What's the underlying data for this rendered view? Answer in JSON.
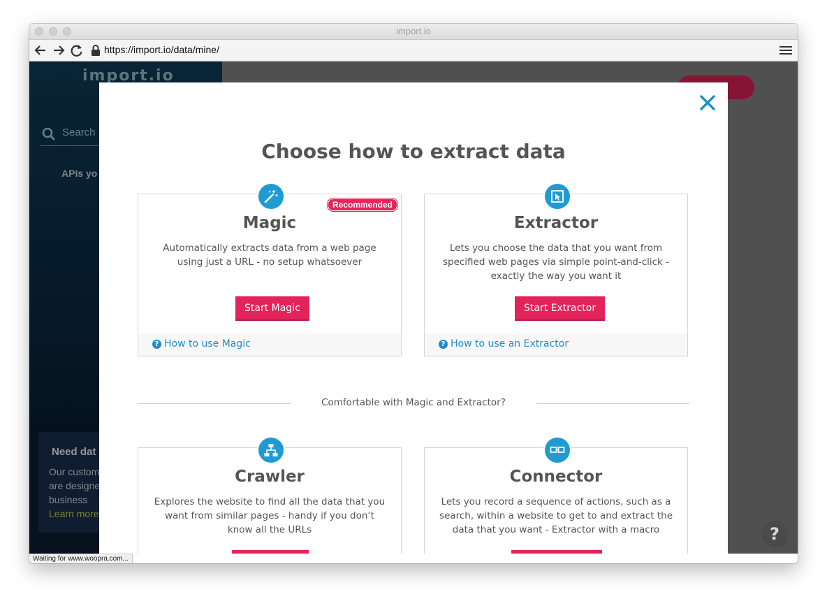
{
  "window": {
    "title": "import.io"
  },
  "browser": {
    "url": "https://import.io/data/mine/"
  },
  "sidebar": {
    "brand": "import.io",
    "search_label": "Search",
    "section_label": "APIs yo",
    "promo": {
      "title": "Need dat",
      "text_line1": "Our custom",
      "text_line2": "are designe",
      "text_line3": "business",
      "link": "Learn more"
    }
  },
  "modal": {
    "title": "Choose how to extract data",
    "divider_text": "Comfortable with Magic and Extractor?",
    "cards": [
      {
        "icon": "magic-wand-icon",
        "badge": "Recommended",
        "title": "Magic",
        "description": "Automatically extracts data from a web page using just a URL - no setup whatsoever",
        "button": "Start Magic",
        "help_link": "How to use Magic"
      },
      {
        "icon": "pointer-select-icon",
        "title": "Extractor",
        "description": "Lets you choose the data that you want from specified web pages via simple point-and-click - exactly the way you want it",
        "button": "Start Extractor",
        "help_link": "How to use an Extractor"
      },
      {
        "icon": "sitemap-icon",
        "title": "Crawler",
        "description": "Explores the website to find all the data that you want from similar pages - handy if you don’t know all the URLs"
      },
      {
        "icon": "link-chain-icon",
        "title": "Connector",
        "description": "Lets you record a sequence of actions, such as a search, within a website to get to and extract the data that you want - Extractor with a macro"
      }
    ]
  },
  "status": {
    "text": "Waiting for www.woopra.com..."
  },
  "colors": {
    "accent": "#e3245a",
    "link": "#1f8ec8",
    "icon_blue": "#1f9bd2",
    "title_gray": "#555555"
  }
}
